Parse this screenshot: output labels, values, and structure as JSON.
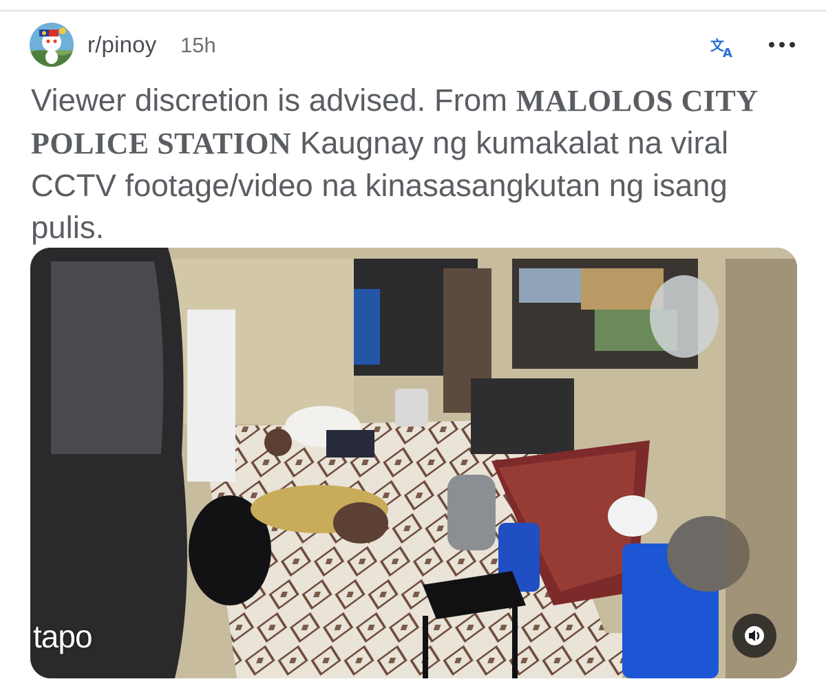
{
  "post": {
    "subreddit": "r/pinoy",
    "time": "15h",
    "title_parts": {
      "lead": "Viewer discretion is advised. From ",
      "caps": "MALOLOS CITY POLICE STATION",
      "tail": " Kaugnay ng kumakalat na viral CCTV footage/video na kinasasangkutan ng isang pulis."
    }
  },
  "media": {
    "watermark": "tapo"
  },
  "icons": {
    "avatar": "subreddit-avatar",
    "translate": "translate-icon",
    "more": "more-icon",
    "audio": "audio-icon"
  },
  "colors": {
    "text": "#5a5e63",
    "divider": "#e6e7e9",
    "translate_accent": "#2a6fd6"
  }
}
